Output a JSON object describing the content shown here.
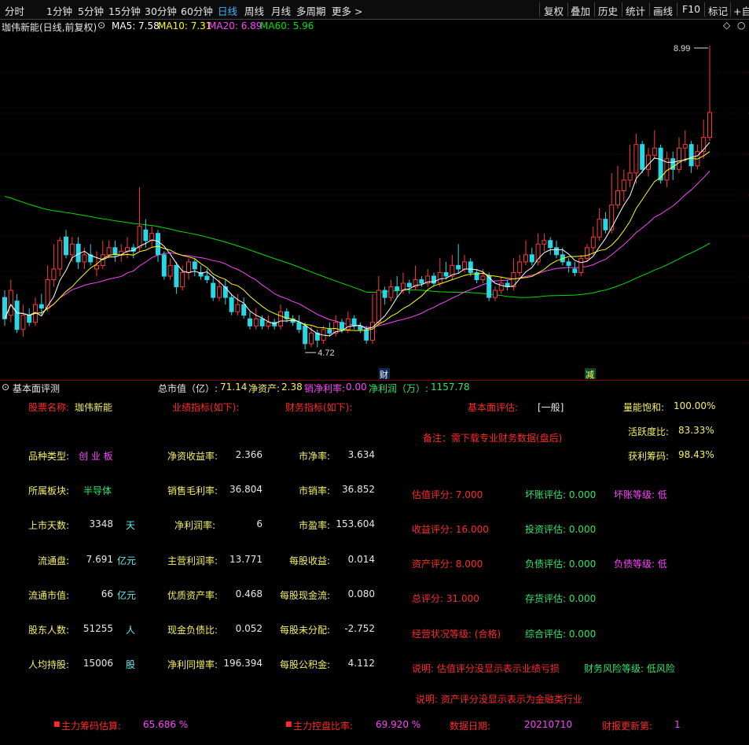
{
  "toolbar": {
    "periods": [
      "分时",
      "1分钟",
      "5分钟",
      "15分钟",
      "30分钟",
      "60分钟",
      "日线",
      "周线",
      "月线",
      "多周期",
      "更多"
    ],
    "active_period": "日线",
    "right_buttons": [
      "复权",
      "叠加",
      "历史",
      "统计",
      "画线",
      "F10",
      "标记",
      "+自"
    ]
  },
  "chart_header": {
    "title": "珈伟新能(日线,前复权)",
    "ma5": "MA5: 7.58",
    "ma10": "MA10: 7.31",
    "ma20": "MA20: 6.89",
    "ma60": "MA60: 5.96",
    "colors": {
      "ma5": "#ffffff",
      "ma10": "#ffff00",
      "ma20": "#ff44ff",
      "ma60": "#00e000"
    }
  },
  "chart_data": {
    "type": "candlestick",
    "high_label": "8.99",
    "low_label": "4.72",
    "markers": [
      "财",
      "减"
    ],
    "candles": [
      {
        "o": 5.45,
        "c": 5.15,
        "h": 5.55,
        "l": 5.05
      },
      {
        "o": 5.2,
        "c": 5.55,
        "h": 5.7,
        "l": 5.1
      },
      {
        "o": 5.4,
        "c": 5.0,
        "h": 5.5,
        "l": 4.95
      },
      {
        "o": 5.0,
        "c": 5.2,
        "h": 5.35,
        "l": 4.9
      },
      {
        "o": 5.2,
        "c": 5.1,
        "h": 5.3,
        "l": 5.05
      },
      {
        "o": 5.1,
        "c": 5.35,
        "h": 5.45,
        "l": 5.05
      },
      {
        "o": 5.35,
        "c": 5.3,
        "h": 5.5,
        "l": 5.2
      },
      {
        "o": 5.3,
        "c": 5.7,
        "h": 5.9,
        "l": 5.25
      },
      {
        "o": 5.7,
        "c": 5.85,
        "h": 6.2,
        "l": 5.6
      },
      {
        "o": 5.85,
        "c": 6.25,
        "h": 6.3,
        "l": 5.75
      },
      {
        "o": 6.3,
        "c": 6.05,
        "h": 6.4,
        "l": 6.0
      },
      {
        "o": 6.05,
        "c": 6.2,
        "h": 6.3,
        "l": 5.95
      },
      {
        "o": 6.2,
        "c": 5.95,
        "h": 6.3,
        "l": 5.85
      },
      {
        "o": 5.95,
        "c": 6.05,
        "h": 6.15,
        "l": 5.85
      },
      {
        "o": 6.05,
        "c": 5.95,
        "h": 6.2,
        "l": 5.9
      },
      {
        "o": 5.85,
        "c": 5.9,
        "h": 6.1,
        "l": 5.75
      },
      {
        "o": 5.9,
        "c": 6.05,
        "h": 6.25,
        "l": 5.85
      },
      {
        "o": 6.05,
        "c": 6.15,
        "h": 6.25,
        "l": 6.0
      },
      {
        "o": 6.15,
        "c": 6.05,
        "h": 6.25,
        "l": 5.95
      },
      {
        "o": 6.05,
        "c": 6.1,
        "h": 6.2,
        "l": 5.95
      },
      {
        "o": 6.1,
        "c": 6.15,
        "h": 6.3,
        "l": 6.0
      },
      {
        "o": 6.15,
        "c": 6.1,
        "h": 6.2,
        "l": 6.0
      },
      {
        "o": 6.15,
        "c": 6.45,
        "h": 7.0,
        "l": 6.1
      },
      {
        "o": 6.4,
        "c": 6.25,
        "h": 6.55,
        "l": 6.15
      },
      {
        "o": 6.25,
        "c": 6.35,
        "h": 6.45,
        "l": 6.15
      },
      {
        "o": 6.35,
        "c": 6.05,
        "h": 6.4,
        "l": 5.95
      },
      {
        "o": 6.05,
        "c": 5.75,
        "h": 6.1,
        "l": 5.7
      },
      {
        "o": 5.75,
        "c": 5.9,
        "h": 6.0,
        "l": 5.7
      },
      {
        "o": 5.9,
        "c": 5.6,
        "h": 5.95,
        "l": 5.5
      },
      {
        "o": 5.6,
        "c": 5.8,
        "h": 5.9,
        "l": 5.55
      },
      {
        "o": 5.8,
        "c": 5.95,
        "h": 6.0,
        "l": 5.7
      },
      {
        "o": 5.95,
        "c": 5.85,
        "h": 6.0,
        "l": 5.75
      },
      {
        "o": 5.8,
        "c": 5.75,
        "h": 5.9,
        "l": 5.7
      },
      {
        "o": 5.75,
        "c": 5.7,
        "h": 5.85,
        "l": 5.65
      },
      {
        "o": 5.65,
        "c": 5.45,
        "h": 5.75,
        "l": 5.4
      },
      {
        "o": 5.45,
        "c": 5.6,
        "h": 5.7,
        "l": 5.4
      },
      {
        "o": 5.6,
        "c": 5.45,
        "h": 5.7,
        "l": 5.35
      },
      {
        "o": 5.45,
        "c": 5.25,
        "h": 5.5,
        "l": 5.2
      },
      {
        "o": 5.25,
        "c": 5.35,
        "h": 5.5,
        "l": 5.2
      },
      {
        "o": 5.35,
        "c": 5.2,
        "h": 5.45,
        "l": 5.15
      },
      {
        "o": 5.15,
        "c": 5.05,
        "h": 5.25,
        "l": 5.0
      },
      {
        "o": 5.05,
        "c": 5.15,
        "h": 5.3,
        "l": 5.0
      },
      {
        "o": 5.15,
        "c": 5.05,
        "h": 5.2,
        "l": 5.0
      },
      {
        "o": 5.05,
        "c": 5.1,
        "h": 5.2,
        "l": 5.0
      },
      {
        "o": 5.1,
        "c": 5.05,
        "h": 5.15,
        "l": 5.0
      },
      {
        "o": 5.05,
        "c": 5.25,
        "h": 5.35,
        "l": 5.0
      },
      {
        "o": 5.25,
        "c": 5.15,
        "h": 5.3,
        "l": 5.1
      },
      {
        "o": 5.15,
        "c": 5.1,
        "h": 5.2,
        "l": 5.05
      },
      {
        "o": 5.1,
        "c": 5.0,
        "h": 5.2,
        "l": 4.95
      },
      {
        "o": 5.05,
        "c": 4.8,
        "h": 5.1,
        "l": 4.72
      },
      {
        "o": 4.8,
        "c": 4.95,
        "h": 5.05,
        "l": 4.75
      },
      {
        "o": 4.95,
        "c": 4.85,
        "h": 5.0,
        "l": 4.75
      },
      {
        "o": 4.85,
        "c": 5.0,
        "h": 5.05,
        "l": 4.8
      },
      {
        "o": 5.0,
        "c": 4.95,
        "h": 5.1,
        "l": 4.9
      },
      {
        "o": 4.95,
        "c": 5.1,
        "h": 5.2,
        "l": 4.9
      },
      {
        "o": 5.1,
        "c": 5.0,
        "h": 5.15,
        "l": 4.95
      },
      {
        "o": 5.0,
        "c": 5.15,
        "h": 5.25,
        "l": 4.95
      },
      {
        "o": 5.15,
        "c": 5.05,
        "h": 5.2,
        "l": 5.0
      },
      {
        "o": 5.05,
        "c": 5.0,
        "h": 5.1,
        "l": 4.95
      },
      {
        "o": 5.0,
        "c": 4.85,
        "h": 5.05,
        "l": 4.8
      },
      {
        "o": 4.85,
        "c": 5.1,
        "h": 5.5,
        "l": 4.8
      },
      {
        "o": 5.1,
        "c": 5.55,
        "h": 5.75,
        "l": 5.05
      },
      {
        "o": 5.55,
        "c": 5.45,
        "h": 5.6,
        "l": 5.35
      },
      {
        "o": 5.45,
        "c": 5.6,
        "h": 5.7,
        "l": 5.4
      },
      {
        "o": 5.6,
        "c": 5.55,
        "h": 5.75,
        "l": 5.45
      },
      {
        "o": 5.55,
        "c": 5.65,
        "h": 5.8,
        "l": 5.5
      },
      {
        "o": 5.65,
        "c": 5.6,
        "h": 5.7,
        "l": 5.5
      },
      {
        "o": 5.6,
        "c": 5.7,
        "h": 5.9,
        "l": 5.55
      },
      {
        "o": 5.7,
        "c": 5.65,
        "h": 5.75,
        "l": 5.6
      },
      {
        "o": 5.65,
        "c": 5.75,
        "h": 5.85,
        "l": 5.6
      },
      {
        "o": 5.75,
        "c": 5.65,
        "h": 5.8,
        "l": 5.6
      },
      {
        "o": 5.65,
        "c": 5.8,
        "h": 6.0,
        "l": 5.6
      },
      {
        "o": 5.8,
        "c": 5.75,
        "h": 5.95,
        "l": 5.7
      },
      {
        "o": 5.75,
        "c": 5.9,
        "h": 6.05,
        "l": 5.7
      },
      {
        "o": 5.9,
        "c": 5.85,
        "h": 6.2,
        "l": 5.8
      },
      {
        "o": 5.85,
        "c": 5.95,
        "h": 6.05,
        "l": 5.8
      },
      {
        "o": 5.95,
        "c": 5.8,
        "h": 6.0,
        "l": 5.75
      },
      {
        "o": 5.8,
        "c": 5.7,
        "h": 5.85,
        "l": 5.65
      },
      {
        "o": 5.7,
        "c": 5.75,
        "h": 5.85,
        "l": 5.65
      },
      {
        "o": 5.75,
        "c": 5.45,
        "h": 5.8,
        "l": 5.4
      },
      {
        "o": 5.45,
        "c": 5.55,
        "h": 5.6,
        "l": 5.4
      },
      {
        "o": 5.55,
        "c": 5.65,
        "h": 5.75,
        "l": 5.5
      },
      {
        "o": 5.65,
        "c": 5.6,
        "h": 5.7,
        "l": 5.55
      },
      {
        "o": 5.6,
        "c": 5.8,
        "h": 6.0,
        "l": 5.55
      },
      {
        "o": 5.8,
        "c": 5.95,
        "h": 6.05,
        "l": 5.75
      },
      {
        "o": 5.95,
        "c": 6.05,
        "h": 6.25,
        "l": 5.9
      },
      {
        "o": 6.05,
        "c": 5.95,
        "h": 6.15,
        "l": 5.9
      },
      {
        "o": 5.95,
        "c": 6.2,
        "h": 6.35,
        "l": 5.9
      },
      {
        "o": 6.2,
        "c": 6.25,
        "h": 6.35,
        "l": 6.1
      },
      {
        "o": 6.25,
        "c": 6.15,
        "h": 6.3,
        "l": 6.05
      },
      {
        "o": 6.15,
        "c": 6.05,
        "h": 6.25,
        "l": 6.0
      },
      {
        "o": 6.05,
        "c": 5.95,
        "h": 6.15,
        "l": 5.9
      },
      {
        "o": 5.95,
        "c": 5.9,
        "h": 6.0,
        "l": 5.8
      },
      {
        "o": 5.85,
        "c": 5.8,
        "h": 5.95,
        "l": 5.75
      },
      {
        "o": 5.8,
        "c": 6.0,
        "h": 6.05,
        "l": 5.75
      },
      {
        "o": 6.0,
        "c": 6.15,
        "h": 6.2,
        "l": 5.95
      },
      {
        "o": 6.15,
        "c": 6.3,
        "h": 6.45,
        "l": 6.05
      },
      {
        "o": 6.3,
        "c": 6.55,
        "h": 6.7,
        "l": 6.25
      },
      {
        "o": 6.55,
        "c": 6.4,
        "h": 6.65,
        "l": 6.35
      },
      {
        "o": 6.4,
        "c": 6.75,
        "h": 7.2,
        "l": 6.35
      },
      {
        "o": 6.75,
        "c": 6.95,
        "h": 7.3,
        "l": 6.7
      },
      {
        "o": 6.95,
        "c": 7.1,
        "h": 7.25,
        "l": 6.8
      },
      {
        "o": 7.1,
        "c": 7.2,
        "h": 7.6,
        "l": 7.0
      },
      {
        "o": 7.2,
        "c": 7.6,
        "h": 7.75,
        "l": 7.05
      },
      {
        "o": 7.6,
        "c": 7.25,
        "h": 7.65,
        "l": 7.2
      },
      {
        "o": 7.25,
        "c": 7.45,
        "h": 7.55,
        "l": 7.15
      },
      {
        "o": 7.45,
        "c": 7.55,
        "h": 7.8,
        "l": 7.4
      },
      {
        "o": 7.55,
        "c": 7.1,
        "h": 7.6,
        "l": 7.05
      },
      {
        "o": 7.1,
        "c": 7.4,
        "h": 7.5,
        "l": 7.0
      },
      {
        "o": 7.4,
        "c": 7.25,
        "h": 7.5,
        "l": 7.1
      },
      {
        "o": 7.25,
        "c": 7.55,
        "h": 7.7,
        "l": 7.2
      },
      {
        "o": 7.55,
        "c": 7.6,
        "h": 7.8,
        "l": 7.35
      },
      {
        "o": 7.6,
        "c": 7.3,
        "h": 7.65,
        "l": 7.2
      },
      {
        "o": 7.3,
        "c": 7.5,
        "h": 7.6,
        "l": 7.25
      },
      {
        "o": 7.5,
        "c": 7.7,
        "h": 7.95,
        "l": 7.4
      },
      {
        "o": 7.7,
        "c": 8.05,
        "h": 8.99,
        "l": 7.65
      }
    ]
  },
  "panel": {
    "title": "基本面评测",
    "summary": {
      "market_cap_label": "总市值（亿）: ",
      "market_cap": "71.14",
      "net_assets_label": "净资产: ",
      "net_assets": "2.38",
      "net_margin_label": "销净利率: ",
      "net_margin": "0.00",
      "net_profit_label": "净利润（万）: ",
      "net_profit": "1157.78"
    },
    "stock_name_label": "股票名称:",
    "stock_name": "珈伟新能",
    "perf_label": "业绩指标(如下):",
    "fin_label": "财务指标(如下):",
    "fund_eval_label": "基本面评估:",
    "fund_eval": "[一般]",
    "volume_sat_label": "量能饱和:",
    "volume_sat": "100.00%",
    "note": "备注：需下载专业财务数据(盘后)",
    "activity_label": "活跃度比:",
    "activity": "83.33%",
    "profit_chip_label": "获利筹码:",
    "profit_chip": "98.43%",
    "left": [
      {
        "label": "品种类型:",
        "value": "创 业 板",
        "unit": ""
      },
      {
        "label": "所属板块:",
        "value": "半导体",
        "unit": ""
      },
      {
        "label": "上市天数:",
        "value": "3348",
        "unit": "天"
      },
      {
        "label": "流通盘:",
        "value": "7.691",
        "unit": "亿元"
      },
      {
        "label": "流通市值:",
        "value": "66",
        "unit": "亿元"
      },
      {
        "label": "股东人数:",
        "value": "51255",
        "unit": "人"
      },
      {
        "label": "人均持股:",
        "value": "15006",
        "unit": "股"
      }
    ],
    "mid1": [
      {
        "label": "净资收益率:",
        "value": "2.366"
      },
      {
        "label": "销售毛利率:",
        "value": "36.804"
      },
      {
        "label": "净利润率:",
        "value": "6"
      },
      {
        "label": "主营利润率:",
        "value": "13.771"
      },
      {
        "label": "优质资产率:",
        "value": "0.468"
      },
      {
        "label": "现金负债比:",
        "value": "0.052"
      },
      {
        "label": "净利同增率:",
        "value": "196.394"
      }
    ],
    "mid2": [
      {
        "label": "市净率:",
        "value": "3.634"
      },
      {
        "label": "市销率:",
        "value": "36.852"
      },
      {
        "label": "市盈率:",
        "value": "153.604"
      },
      {
        "label": "每股收益:",
        "value": "0.014"
      },
      {
        "label": "每股现金流:",
        "value": "0.080"
      },
      {
        "label": "每股未分配:",
        "value": "-2.752"
      },
      {
        "label": "每股公积金:",
        "value": "4.112"
      }
    ],
    "scores": {
      "valuation": "估值评分: 7.000",
      "income": "收益评分: 16.000",
      "asset": "资产评分: 8.000",
      "total": "总评分: 31.000",
      "operation": "经营状况等级: (合格)",
      "bad_debt": "坏账评估: 0.000",
      "invest": "投资评估: 0.000",
      "liability": "负债评估: 0.000",
      "inventory": "存货评估: 0.000",
      "overall": "综合评估: 0.000",
      "bad_debt_grade": "坏账等级: 低",
      "liability_grade": "负债等级: 低",
      "desc1": "说明: 估值评分没显示表示业绩亏损",
      "fin_risk": "财务风险等级: 低风险",
      "desc2": "说明: 资产评分没显示表示为金融类行业"
    },
    "footer": {
      "main_chip_label": "主力筹码估算:",
      "main_chip": "65.686 %",
      "main_ctrl_label": "主力控盘比率:",
      "main_ctrl": "69.920 %",
      "data_date_label": "数据日期:",
      "data_date": "20210710",
      "report_update_label": "财报更新第:",
      "report_update": "1"
    }
  }
}
